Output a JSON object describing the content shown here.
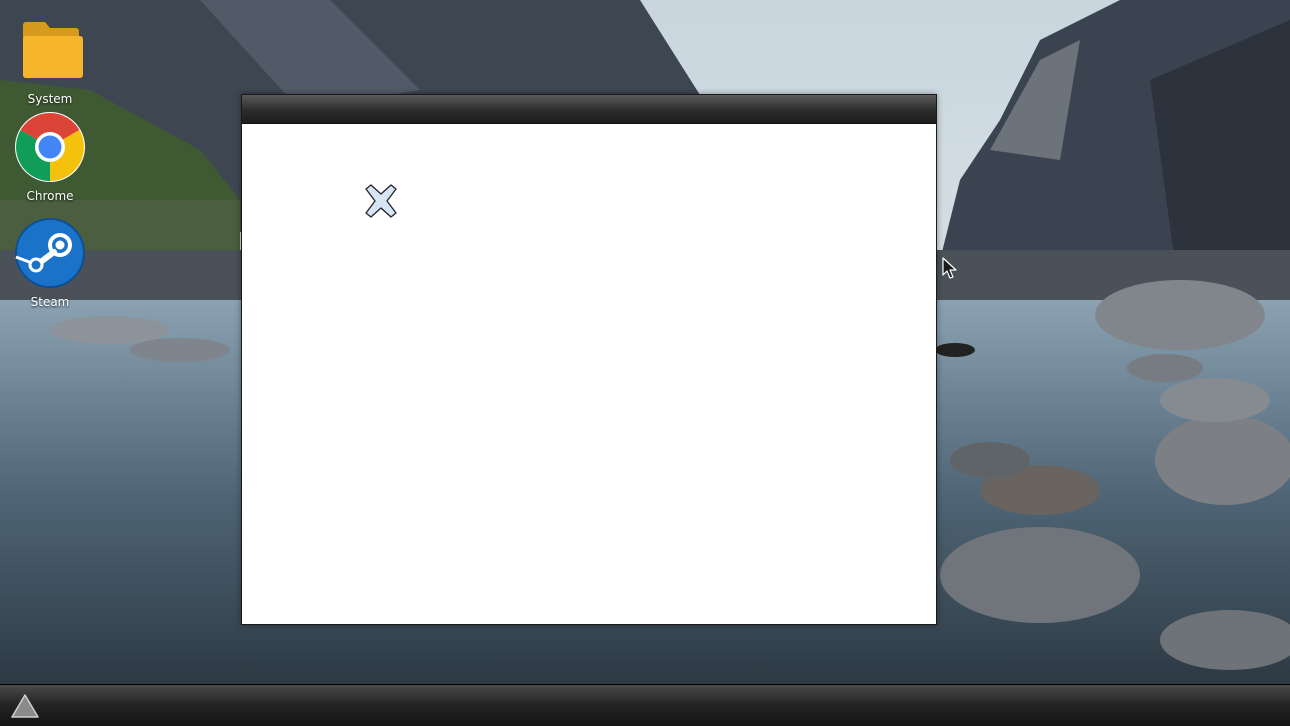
{
  "desktop": {
    "icons": [
      {
        "name": "system",
        "label": "System",
        "icon": "folder-icon"
      },
      {
        "name": "chrome",
        "label": "Chrome",
        "icon": "chrome-icon"
      },
      {
        "name": "steam",
        "label": "Steam",
        "icon": "steam-icon"
      }
    ]
  },
  "window": {
    "title": "",
    "body_icon": "close-x-icon"
  },
  "taskbar": {
    "start_icon": "triangle-up-icon"
  },
  "colors": {
    "titlebar": "#2c2c2c",
    "taskbar": "#262626",
    "window_bg": "#ffffff",
    "folder": "#f6b52a",
    "chrome_red": "#db4437",
    "chrome_green": "#0f9d58",
    "chrome_yellow": "#f4c20d",
    "chrome_blue": "#4285f4",
    "steam_blue": "#1a73c8"
  }
}
